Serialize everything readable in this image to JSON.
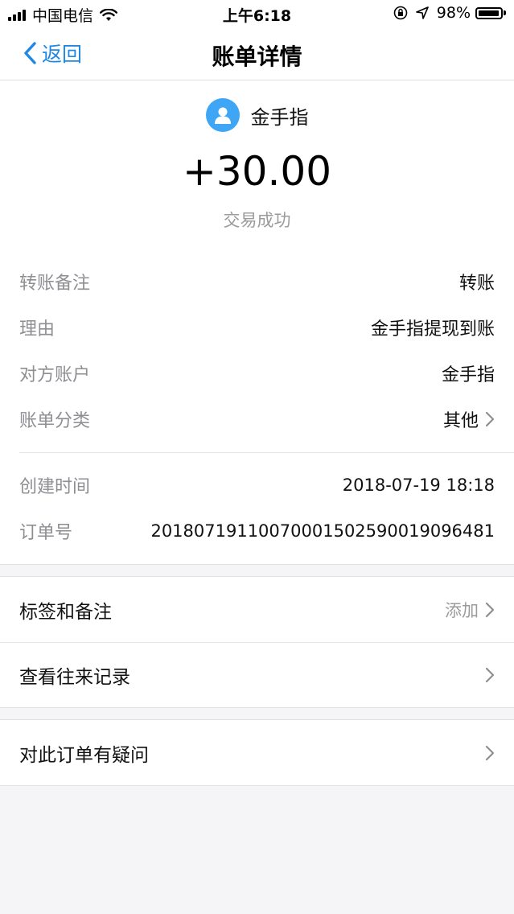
{
  "status_bar": {
    "carrier": "中国电信",
    "time": "上午6:18",
    "battery": "98%",
    "battery_level": 0.98
  },
  "nav": {
    "back_label": "返回",
    "title": "账单详情"
  },
  "bill": {
    "payer_name": "金手指",
    "amount": "+30.00",
    "status": "交易成功",
    "fields": [
      {
        "label": "转账备注",
        "value": "转账"
      },
      {
        "label": "理由",
        "value": "金手指提现到账"
      },
      {
        "label": "对方账户",
        "value": "金手指"
      },
      {
        "label": "账单分类",
        "value": "其他"
      }
    ],
    "meta": [
      {
        "label": "创建时间",
        "value": "2018-07-19 18:18"
      },
      {
        "label": "订单号",
        "value": "20180719110070001502590019096481"
      }
    ]
  },
  "actions": {
    "tags": {
      "label": "标签和备注",
      "hint": "添加"
    },
    "history": {
      "label": "查看往来记录"
    },
    "question": {
      "label": "对此订单有疑问"
    }
  },
  "colors": {
    "accent": "#1e88e5",
    "avatar": "#3ea6f5",
    "muted": "#8e8e93",
    "background": "#f5f5f7"
  }
}
